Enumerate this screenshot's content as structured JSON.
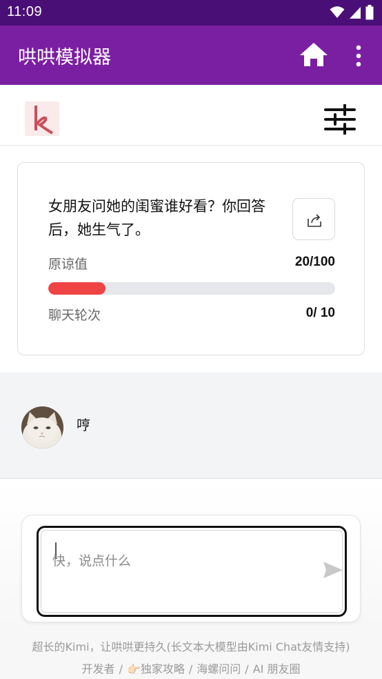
{
  "status_bar": {
    "time": "11:09"
  },
  "app_bar": {
    "title": "哄哄模拟器"
  },
  "scenario": {
    "question": "女朋友问她的闺蜜谁好看？你回答后，她生气了。",
    "forgiveness_label": "原谅值",
    "forgiveness_value": "20/100",
    "forgiveness_fraction": 0.2,
    "rounds_label": "聊天轮次",
    "rounds_value": "0/ 10"
  },
  "chat": {
    "messages": [
      {
        "text": "哼"
      }
    ]
  },
  "input": {
    "placeholder": "快，说点什么"
  },
  "footer": {
    "line1": "超长的Kimi，让哄哄更持久(长文本大模型由Kimi Chat友情支持)",
    "links": [
      "开发者",
      "👉🏻独家攻略",
      "海螺问问",
      "AI 朋友圈"
    ],
    "separator": "/"
  },
  "colors": {
    "app_bar": "#7b1fa2",
    "status_bar": "#4a0f77",
    "progress": "#ef4444"
  },
  "icons": [
    "wifi-icon",
    "signal-icon",
    "battery-icon",
    "home-icon",
    "more-vert-icon",
    "sliders-icon",
    "share-icon",
    "send-icon"
  ]
}
